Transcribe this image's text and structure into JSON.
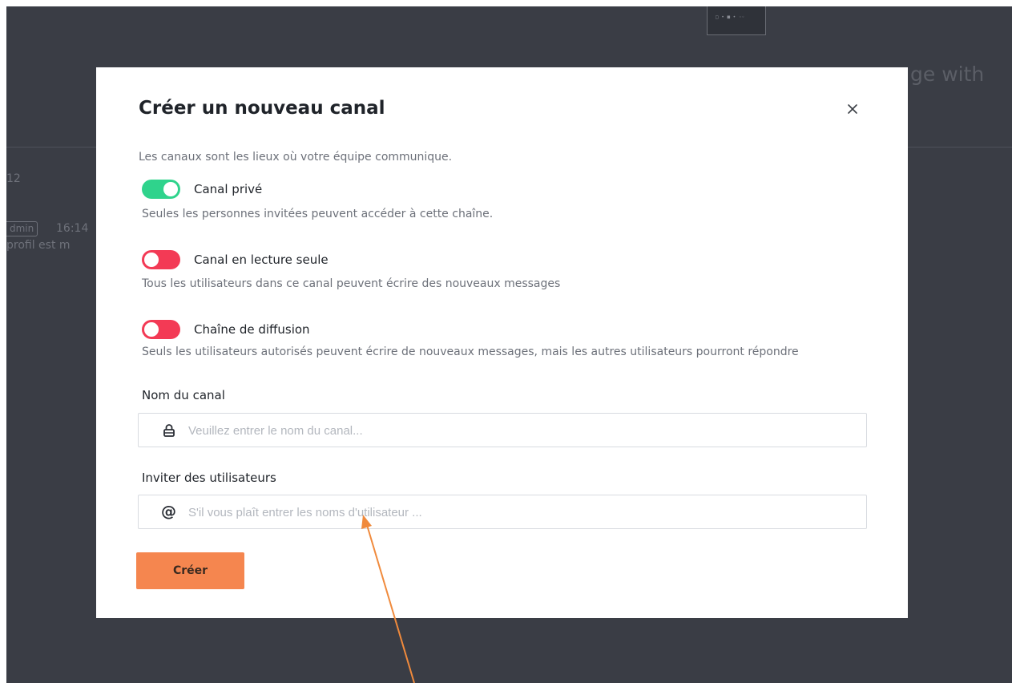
{
  "background": {
    "heading": "",
    "heading_tail": "ge with",
    "time_partial": "12",
    "badge_partial": "dmin",
    "badge_time": "16:14",
    "profile_partial": "profil est m",
    "thumbnail_text": "□ • ■ • ◦◦"
  },
  "modal": {
    "title": "Créer un nouveau canal",
    "close_icon": "close-icon",
    "description": "Les canaux sont les lieux où votre équipe communique.",
    "options": [
      {
        "label": "Canal privé",
        "help": "Seules les personnes invitées peuvent accéder à cette chaîne.",
        "state": "on",
        "color": "#2fd38c"
      },
      {
        "label": "Canal en lecture seule",
        "help": "Tous les utilisateurs dans ce canal peuvent écrire des nouveaux messages",
        "state": "off",
        "color": "#f33a55"
      },
      {
        "label": "Chaîne de diffusion",
        "help": "Seuls les utilisateurs autorisés peuvent écrire de nouveaux messages, mais les autres utilisateurs pourront répondre",
        "state": "off",
        "color": "#f33a55"
      }
    ],
    "channel_name": {
      "label": "Nom du canal",
      "placeholder": "Veuillez entrer le nom du canal...",
      "value": "",
      "icon": "lock-icon"
    },
    "invite_users": {
      "label": "Inviter des utilisateurs",
      "placeholder": "S'il vous plaît entrer les noms d'utilisateur ...",
      "value": "",
      "icon": "at-icon",
      "icon_glyph": "@"
    },
    "create_button": "Créer"
  },
  "colors": {
    "accent": "#f5864f",
    "toggle_on": "#2fd38c",
    "toggle_off": "#f33a55",
    "backdrop": "#3a3d45",
    "annotation_arrow": "#f08a3c"
  }
}
